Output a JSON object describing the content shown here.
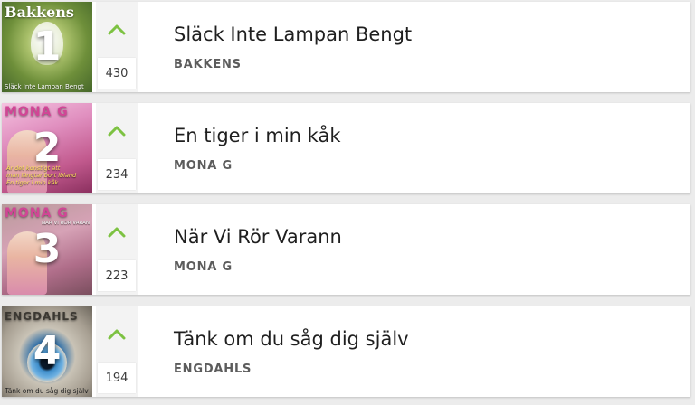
{
  "accent_color": "#7dc242",
  "songs": [
    {
      "rank": "1",
      "title": "Släck Inte Lampan Bengt",
      "artist": "BAKKENS",
      "votes": "430",
      "cover": {
        "title": "Bakkens",
        "subtitle": "Släck Inte Lampan Bengt",
        "tagline": []
      }
    },
    {
      "rank": "2",
      "title": "En tiger i min kåk",
      "artist": "MONA G",
      "votes": "234",
      "cover": {
        "title": "MONA G",
        "subtitle": "",
        "tagline": [
          "Är det konstigt att",
          "man längtar bort ibland",
          "En tiger i min kåk"
        ]
      }
    },
    {
      "rank": "3",
      "title": "När Vi Rör Varann",
      "artist": "MONA G",
      "votes": "223",
      "cover": {
        "title": "MONA G",
        "subtitle": "NÄR VI RÖR VARANN",
        "tagline": []
      }
    },
    {
      "rank": "4",
      "title": "Tänk om du såg dig själv",
      "artist": "ENGDAHLS",
      "votes": "194",
      "cover": {
        "title": "ENGDAHLS",
        "subtitle": "Tänk om du såg dig själv",
        "tagline": []
      }
    }
  ]
}
